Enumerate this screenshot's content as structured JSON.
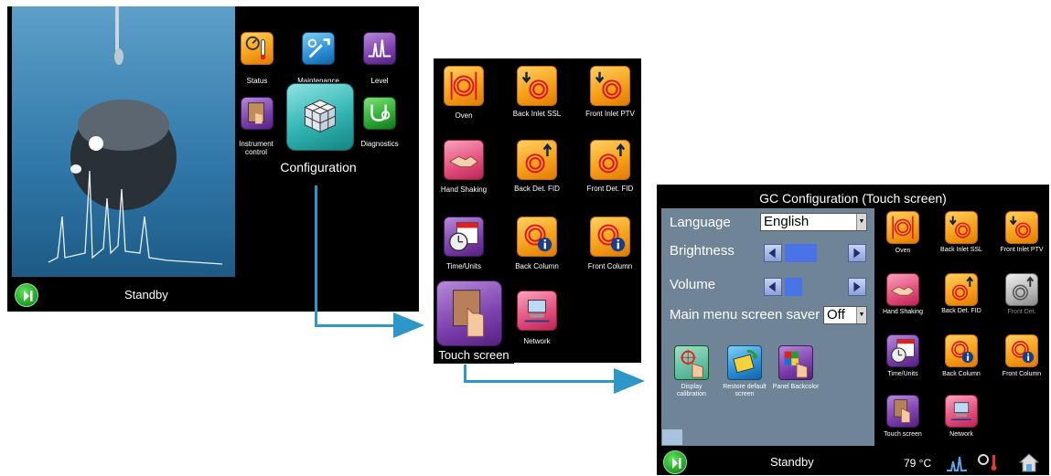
{
  "screen1": {
    "menu": [
      {
        "label": "Status",
        "icon": "status-icon"
      },
      {
        "label": "Maintenance",
        "icon": "maintenance-icon"
      },
      {
        "label": "Level",
        "icon": "level-icon"
      },
      {
        "label": "Instrument control",
        "icon": "instrument-control-icon"
      },
      {
        "label": "Configuration",
        "icon": "configuration-icon"
      },
      {
        "label": "Diagnostics",
        "icon": "diagnostics-icon"
      }
    ],
    "status": "Standby"
  },
  "screen2": {
    "items": [
      {
        "label": "Oven"
      },
      {
        "label": "Back Inlet SSL"
      },
      {
        "label": "Front Inlet PTV"
      },
      {
        "label": "Hand Shaking"
      },
      {
        "label": "Back Det. FID"
      },
      {
        "label": "Front Det. FID"
      },
      {
        "label": "Time/Units"
      },
      {
        "label": "Back Column"
      },
      {
        "label": "Front Column"
      },
      {
        "label": "Touch screen"
      },
      {
        "label": "Network"
      }
    ]
  },
  "screen3": {
    "title": "GC Configuration  (Touch screen)",
    "settings": {
      "language_label": "Language",
      "language_value": "English",
      "brightness_label": "Brightness",
      "brightness_level": 0.55,
      "volume_label": "Volume",
      "volume_level": 0.3,
      "saver_label": "Main menu screen saver",
      "saver_value": "Off"
    },
    "actions": [
      {
        "label": "Display calibration"
      },
      {
        "label": "Restore default screen"
      },
      {
        "label": "Panel Backcolor"
      }
    ],
    "items": [
      {
        "label": "Oven"
      },
      {
        "label": "Back Inlet SSL"
      },
      {
        "label": "Front Inlet PTV"
      },
      {
        "label": "Hand Shaking"
      },
      {
        "label": "Back Det. FID"
      },
      {
        "label": "Front Det."
      },
      {
        "label": "Time/Units"
      },
      {
        "label": "Back Column"
      },
      {
        "label": "Front Column"
      },
      {
        "label": "Touch screen"
      },
      {
        "label": "Network"
      }
    ],
    "status": "Standby",
    "temperature": "79 °C"
  },
  "colors": {
    "arrow": "#2f96c9",
    "settings_panel": "#6f8497",
    "accent_orange": "#f7a21b"
  }
}
